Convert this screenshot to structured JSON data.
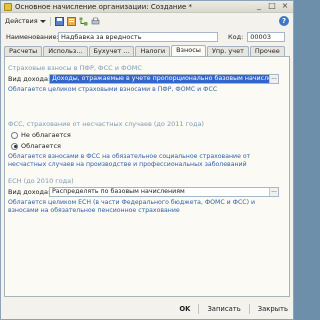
{
  "window": {
    "title": "Основное начисление организации: Создание *",
    "controls": [
      "_",
      "□",
      "×"
    ]
  },
  "toolbar": {
    "actions_label": "Действия",
    "help": "?"
  },
  "header": {
    "name_label": "Наименование:",
    "name_value": "Надбавка за вредность",
    "code_label": "Код:",
    "code_value": "00003"
  },
  "tabs": [
    {
      "label": "Расчеты"
    },
    {
      "label": "Использ..."
    },
    {
      "label": "Бухучет ..."
    },
    {
      "label": "Налоги"
    },
    {
      "label": "Взносы"
    },
    {
      "label": "Упр. учет"
    },
    {
      "label": "Прочее"
    }
  ],
  "active_tab": "Взносы",
  "insurance": {
    "title": "Страховые взносы в ПФР, ФСС и ФОМС",
    "income_label": "Вид дохода:",
    "income_value": "Доходы, отражаемые в учете пропорционально базовым начислениям",
    "hint": "Облагается целиком страховыми взносами в ПФР, ФОМС и ФСС"
  },
  "fss_accident": {
    "title": "ФСС, страхование от несчастных случаев (до 2011 года)",
    "option_not_taxed": "Не облагается",
    "option_taxed": "Облагается",
    "selected": "Облагается",
    "hint": "Облагается взносами в ФСС на обязательное социальное страхование от несчастных случаев на производстве и профессиональных заболеваний"
  },
  "esn": {
    "title": "ЕСН (до 2010 года)",
    "income_label": "Вид дохода:",
    "income_value": "Распределять по базовым начислениям",
    "hint": "Облагается целиком ЕСН (в части Федерального бюджета, ФОМС и ФСС) и взносами на обязательное пенсионное страхование"
  },
  "footer": {
    "ok": "OK",
    "save": "Записать",
    "close": "Закрыть"
  },
  "colors": {
    "accent": "#3366cc",
    "hint_text": "#2f5fa7",
    "section_title": "#7e9bb3"
  }
}
